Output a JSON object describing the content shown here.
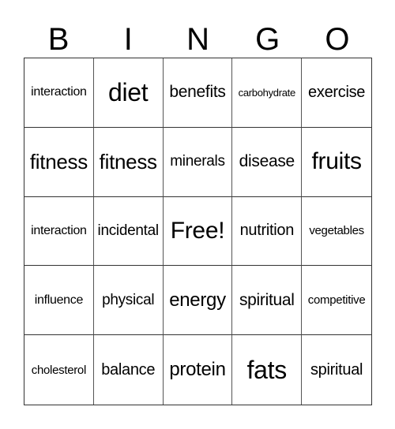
{
  "header": [
    "B",
    "I",
    "N",
    "G",
    "O"
  ],
  "cells": [
    [
      "interaction",
      "diet",
      "benefits",
      "carbohydrate",
      "exercise"
    ],
    [
      "fitness",
      "fitness",
      "minerals",
      "disease",
      "fruits"
    ],
    [
      "interaction",
      "incidental",
      "Free!",
      "nutrition",
      "vegetables"
    ],
    [
      "influence",
      "physical",
      "energy",
      "spiritual",
      "competitive"
    ],
    [
      "cholesterol",
      "balance",
      "protein",
      "fats",
      "spiritual"
    ]
  ]
}
